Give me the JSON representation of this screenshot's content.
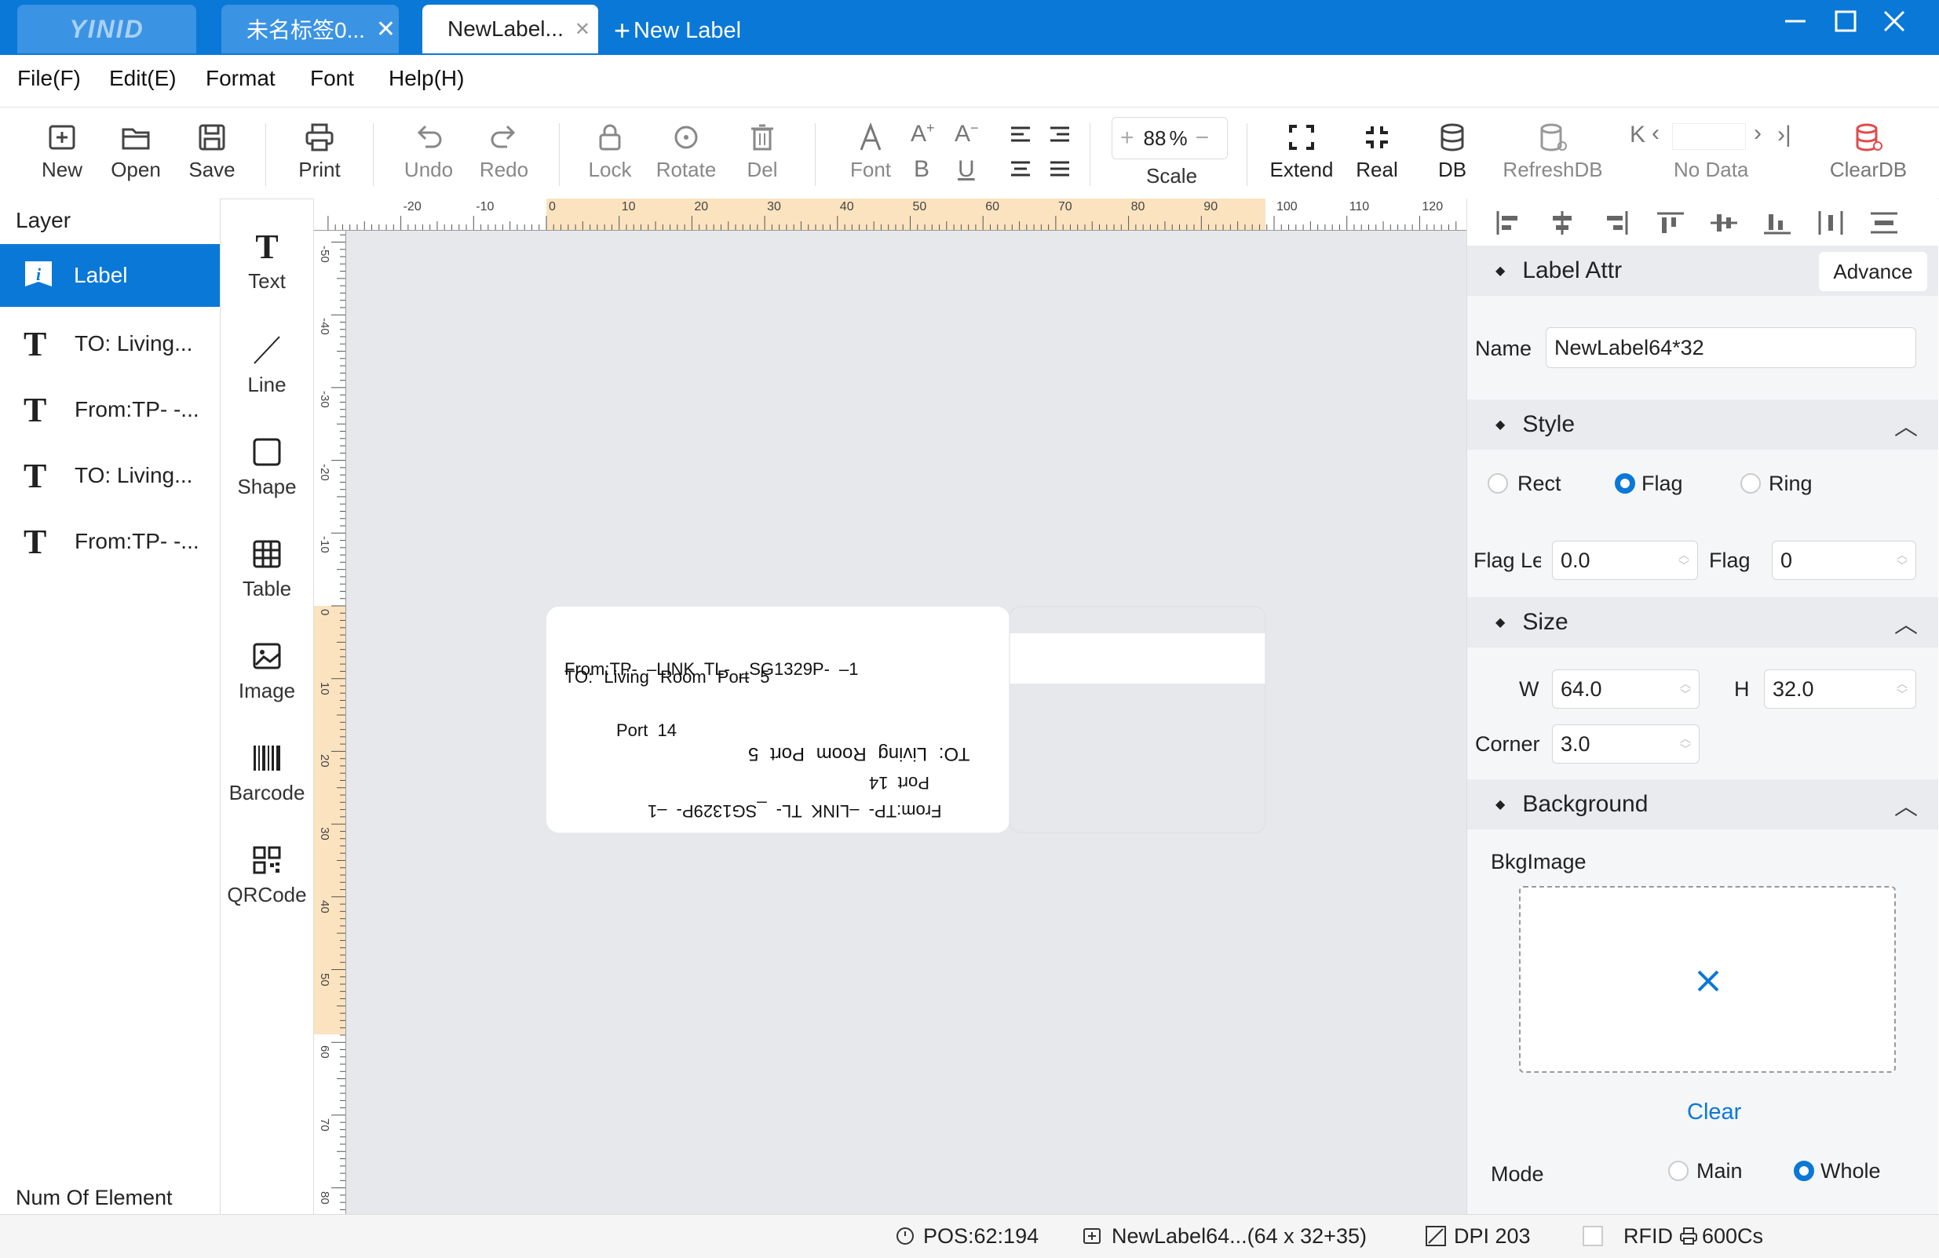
{
  "titlebar": {
    "logo": "YINID",
    "tabs": [
      {
        "label": "未名标签0...",
        "close": "✕"
      },
      {
        "label": "NewLabel...",
        "close": "✕"
      }
    ],
    "new_label": "New Label"
  },
  "menu": [
    "File(F)",
    "Edit(E)",
    "Format",
    "Font",
    "Help(H)"
  ],
  "toolbar": {
    "new": "New",
    "open": "Open",
    "save": "Save",
    "print": "Print",
    "undo": "Undo",
    "redo": "Redo",
    "lock": "Lock",
    "rotate": "Rotate",
    "del": "Del",
    "font": "Font",
    "scale_value": "88",
    "scale_unit": "%",
    "scale": "Scale",
    "extend": "Extend",
    "real": "Real",
    "db": "DB",
    "refreshdb": "RefreshDB",
    "nodata": "No Data",
    "cleardb": "ClearDB"
  },
  "layers": {
    "title": "Layer",
    "items": [
      "Label",
      "TO: Living...",
      "From:TP- -...",
      "TO: Living...",
      "From:TP- -..."
    ],
    "footer": "Num Of Element"
  },
  "tools": [
    "Text",
    "Line",
    "Shape",
    "Table",
    "Image",
    "Barcode",
    "QRCode"
  ],
  "rulers": {
    "h": [
      "-20",
      "-10",
      "0",
      "10",
      "20",
      "30",
      "40",
      "50",
      "60",
      "70",
      "80",
      "90",
      "100",
      "110",
      "120"
    ],
    "v": [
      "-50",
      "-40",
      "-30",
      "-20",
      "-10",
      "0",
      "10",
      "20",
      "30",
      "40",
      "50",
      "60",
      "70",
      "80"
    ]
  },
  "label": {
    "line1": "From:TP- –LINK TL- _SG1329P- –1",
    "line2": "Port 14",
    "line3": "TO: Living Room Port 5",
    "rot1": "TO: Living Room Port 5",
    "rot2": "Port 14",
    "rot3": "From:TP- –LINK TL- _SG1329P- –1"
  },
  "panel": {
    "label_attr": "Label Attr",
    "advance": "Advance",
    "name_label": "Name",
    "name_value": "NewLabel64*32",
    "style": "Style",
    "rect": "Rect",
    "flag": "Flag",
    "ring": "Ring",
    "flag_le": "Flag Le",
    "flag_le_value": "0.0",
    "flag2": "Flag",
    "flag2_value": "0",
    "size": "Size",
    "w": "W",
    "w_value": "64.0",
    "h": "H",
    "h_value": "32.0",
    "corner": "Corner",
    "corner_value": "3.0",
    "background": "Background",
    "bkgimage": "BkgImage",
    "clear": "Clear",
    "mode": "Mode",
    "main": "Main",
    "whole": "Whole"
  },
  "status": {
    "pos": "POS:62:194",
    "file": "NewLabel64...(64 x 32+35)",
    "dpi": "DPI 203",
    "rfid": "RFID",
    "printer": "600Cs"
  },
  "colors": {
    "accent": "#0a78d7",
    "ruler_highlight": "#fce3bf"
  }
}
